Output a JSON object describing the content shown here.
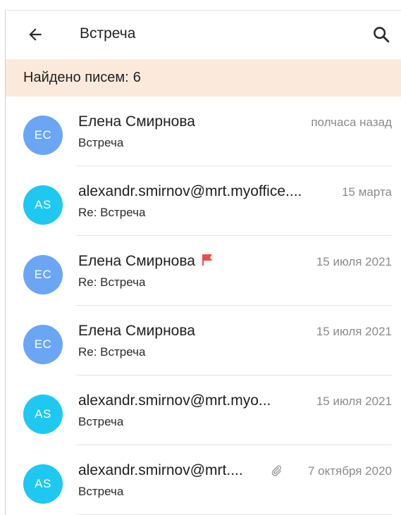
{
  "header": {
    "title": "Встреча",
    "back_icon": "arrow-left-icon",
    "search_icon": "search-icon"
  },
  "banner": {
    "label": "Найдено писем:",
    "count": "6",
    "background": "#fbeadb"
  },
  "colors": {
    "avatar_ec": "#6aa6f4",
    "avatar_as": "#1fc8f0",
    "flag": "#f04a4a",
    "date": "#8a8a8a"
  },
  "messages": [
    {
      "initials": "ЕС",
      "sender": "Елена Смирнова",
      "subject": "Встреча",
      "date": "полчаса назад",
      "flagged": false,
      "attachment": false,
      "avatar_color": "#6aa6f4"
    },
    {
      "initials": "AS",
      "sender": "alexandr.smirnov@mrt.myoffice....",
      "subject": "Re: Встреча",
      "date": "15 марта",
      "flagged": false,
      "attachment": false,
      "avatar_color": "#1fc8f0"
    },
    {
      "initials": "ЕС",
      "sender": "Елена Смирнова",
      "subject": "Re: Встреча",
      "date": "15 июля 2021",
      "flagged": true,
      "attachment": false,
      "avatar_color": "#6aa6f4"
    },
    {
      "initials": "ЕС",
      "sender": "Елена Смирнова",
      "subject": "Re: Встреча",
      "date": "15 июля 2021",
      "flagged": false,
      "attachment": false,
      "avatar_color": "#6aa6f4"
    },
    {
      "initials": "AS",
      "sender": "alexandr.smirnov@mrt.myo...",
      "subject": "Встреча",
      "date": "15 июля 2021",
      "flagged": false,
      "attachment": false,
      "avatar_color": "#1fc8f0"
    },
    {
      "initials": "AS",
      "sender": "alexandr.smirnov@mrt....",
      "subject": "Встреча",
      "date": "7 октября 2020",
      "flagged": false,
      "attachment": true,
      "avatar_color": "#1fc8f0"
    }
  ]
}
